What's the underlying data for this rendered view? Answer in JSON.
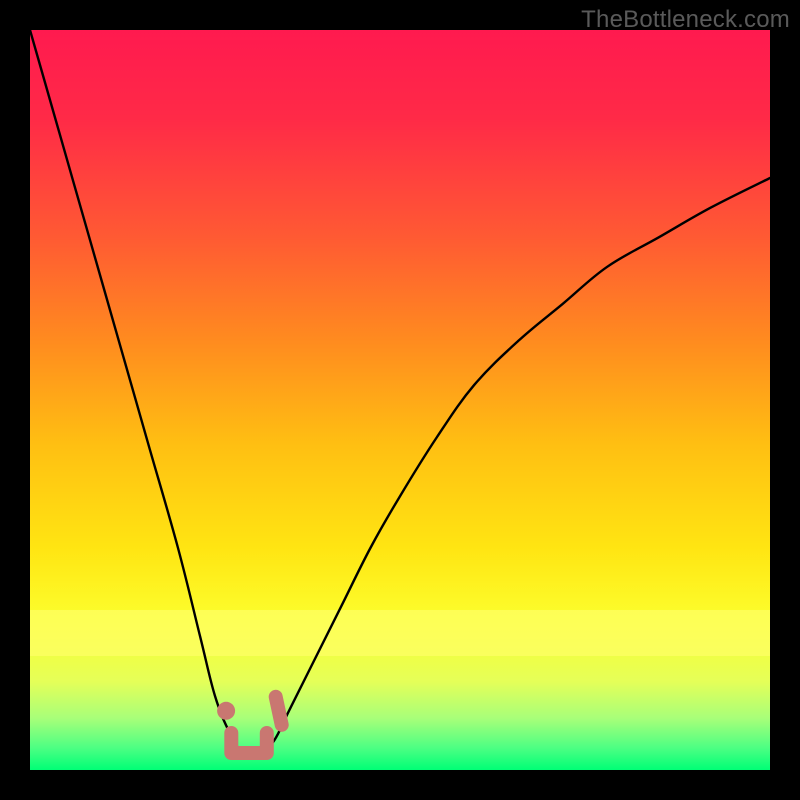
{
  "watermark": "TheBottleneck.com",
  "colors": {
    "curve": "#000000",
    "marker": "#c97771"
  },
  "chart_data": {
    "type": "line",
    "title": "",
    "xlabel": "",
    "ylabel": "",
    "xlim": [
      0,
      100
    ],
    "ylim": [
      0,
      100
    ],
    "x": [
      0,
      4,
      8,
      12,
      16,
      20,
      23,
      25,
      27,
      29,
      31,
      33,
      35,
      38,
      42,
      46,
      50,
      55,
      60,
      66,
      72,
      78,
      85,
      92,
      100
    ],
    "values": [
      100,
      86,
      72,
      58,
      44,
      30,
      18,
      10,
      5,
      2,
      2,
      4,
      8,
      14,
      22,
      30,
      37,
      45,
      52,
      58,
      63,
      68,
      72,
      76,
      80
    ],
    "valley_markers": [
      {
        "x": 26.5,
        "y": 8,
        "kind": "dot"
      },
      {
        "x": 27.2,
        "y": 3,
        "kind": "bracket-left"
      },
      {
        "x": 32.0,
        "y": 3,
        "kind": "bracket-right"
      },
      {
        "x": 33.2,
        "y": 8,
        "kind": "tick"
      }
    ],
    "bracket": {
      "x0": 27.2,
      "x1": 32.0,
      "y": 2.3
    }
  }
}
